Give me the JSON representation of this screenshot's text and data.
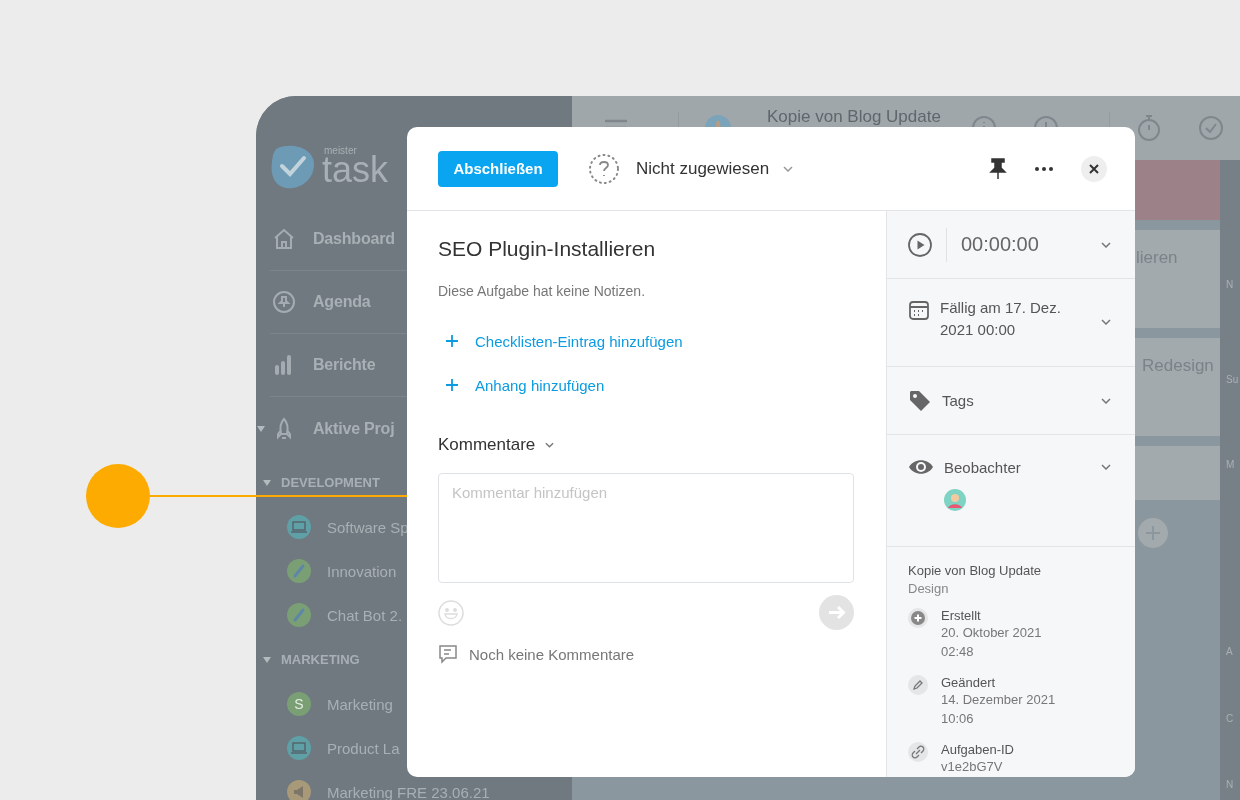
{
  "sidebar": {
    "logo_small": "meister",
    "logo": "task",
    "nav": [
      {
        "kind": "home",
        "label": "Dashboard"
      },
      {
        "kind": "pin",
        "label": "Agenda"
      },
      {
        "kind": "bars",
        "label": "Berichte"
      },
      {
        "kind": "rocket",
        "label": "Aktive Proj"
      }
    ],
    "groups": [
      {
        "label": "DEVELOPMENT",
        "expanded": true,
        "projects": [
          {
            "kind": "laptop",
            "name": "Software Sp",
            "color": "#5fa0a6"
          },
          {
            "kind": "brush",
            "name": "Innovation",
            "color": "#7a9f74"
          },
          {
            "kind": "brush",
            "name": "Chat Bot 2.",
            "color": "#7a9f74"
          }
        ]
      },
      {
        "label": "MARKETING",
        "expanded": true,
        "projects": [
          {
            "kind": "letter",
            "letter": "S",
            "name": "Marketing",
            "color": "#7a9f74"
          },
          {
            "kind": "laptop",
            "name": "Product La",
            "color": "#5fa0a6"
          },
          {
            "kind": "megaphone",
            "name": "Marketing FRE 23.06.21",
            "color": "#a89a78"
          }
        ]
      }
    ]
  },
  "topbar": {
    "project": "Kopie von Blog Update"
  },
  "board": {
    "cards": [
      {
        "color": "#9c8189"
      },
      {
        "text": "lieren",
        "color": "#a3aaae"
      },
      {
        "text": "Redesign",
        "color": "#a3aaae"
      },
      {
        "color": "#a3aaae"
      }
    ]
  },
  "side_column": {
    "labels": [
      "N",
      "Su",
      "M",
      "A",
      "C",
      "N"
    ]
  },
  "task": {
    "complete_button": "Abschließen",
    "assignee": "Nicht zugewiesen",
    "title": "SEO Plugin-Installieren",
    "notes": "Diese Aufgabe hat keine Notizen.",
    "actions": [
      "Checklisten-Eintrag hinzufügen",
      "Anhang hinzufügen"
    ],
    "comments_heading": "Kommentare",
    "comment_placeholder": "Kommentar hinzufügen",
    "no_comments": "Noch keine Kommentare"
  },
  "details": {
    "timer": "00:00:00",
    "due": "Fällig am 17. Dez. 2021 00:00",
    "tags": "Tags",
    "watchers": "Beobachter",
    "project": "Kopie von Blog Update",
    "section": "Design",
    "history": [
      {
        "kind": "created",
        "label": "Erstellt",
        "value": "20. Oktober 2021 02:48"
      },
      {
        "kind": "changed",
        "label": "Geändert",
        "value": "14. Dezember 2021 10:06"
      },
      {
        "kind": "id",
        "label": "Aufgaben-ID",
        "value": "v1e2bG7V"
      }
    ]
  }
}
